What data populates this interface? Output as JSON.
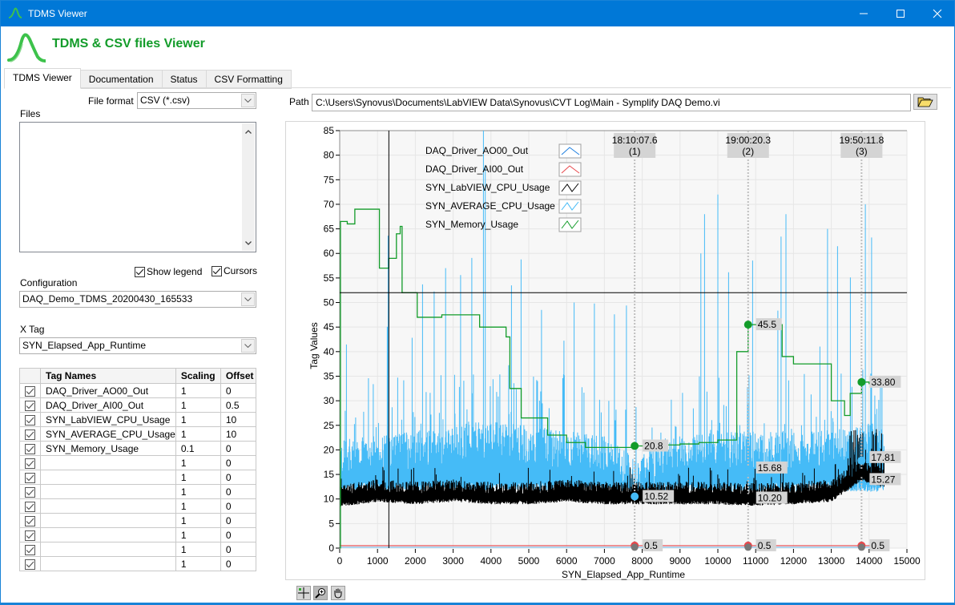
{
  "window": {
    "title": "TDMS Viewer",
    "controls": [
      "minimize",
      "maximize",
      "close"
    ]
  },
  "header": {
    "title": "TDMS & CSV files Viewer",
    "brand_color": "#139c2a"
  },
  "tabs": [
    {
      "label": "TDMS Viewer",
      "active": true
    },
    {
      "label": "Documentation",
      "active": false
    },
    {
      "label": "Status",
      "active": false
    },
    {
      "label": "CSV Formatting",
      "active": false
    }
  ],
  "left_panel": {
    "file_format_label": "File format",
    "file_format_value": "CSV (*.csv)",
    "files_label": "Files",
    "files": [],
    "show_legend_label": "Show legend",
    "show_legend_checked": true,
    "cursors_label": "Cursors",
    "cursors_checked": true,
    "configuration_label": "Configuration",
    "configuration_value": "DAQ_Demo_TDMS_20200430_165533",
    "xtag_label": "X Tag",
    "xtag_value": "SYN_Elapsed_App_Runtime"
  },
  "tag_table": {
    "headers": [
      "Tag Names",
      "Scaling",
      "Offset"
    ],
    "rows": [
      {
        "checked": true,
        "name": "DAQ_Driver_AO00_Out",
        "scaling": "1",
        "offset": "0"
      },
      {
        "checked": true,
        "name": "DAQ_Driver_AI00_Out",
        "scaling": "1",
        "offset": "0.5"
      },
      {
        "checked": true,
        "name": "SYN_LabVIEW_CPU_Usage",
        "scaling": "1",
        "offset": "10"
      },
      {
        "checked": true,
        "name": "SYN_AVERAGE_CPU_Usage",
        "scaling": "1",
        "offset": "10"
      },
      {
        "checked": true,
        "name": "SYN_Memory_Usage",
        "scaling": "0.1",
        "offset": "0"
      },
      {
        "checked": true,
        "name": "",
        "scaling": "1",
        "offset": "0"
      },
      {
        "checked": true,
        "name": "",
        "scaling": "1",
        "offset": "0"
      },
      {
        "checked": true,
        "name": "",
        "scaling": "1",
        "offset": "0"
      },
      {
        "checked": true,
        "name": "",
        "scaling": "1",
        "offset": "0"
      },
      {
        "checked": true,
        "name": "",
        "scaling": "1",
        "offset": "0"
      },
      {
        "checked": true,
        "name": "",
        "scaling": "1",
        "offset": "0"
      },
      {
        "checked": true,
        "name": "",
        "scaling": "1",
        "offset": "0"
      },
      {
        "checked": true,
        "name": "",
        "scaling": "1",
        "offset": "0"
      }
    ]
  },
  "path": {
    "label": "Path",
    "value": "C:\\Users\\Synovus\\Documents\\LabVIEW Data\\Synovus\\CVT Log\\Main - Symplify DAQ Demo.vi"
  },
  "palette_tools": [
    "cursor-move-tool",
    "zoom-tool",
    "pan-tool"
  ],
  "chart_data": {
    "type": "line",
    "title": "",
    "xlabel": "SYN_Elapsed_App_Runtime",
    "ylabel": "Tag Values",
    "xlim": [
      0,
      15000
    ],
    "ylim": [
      0,
      85
    ],
    "xticks": [
      0,
      1000,
      2000,
      3000,
      4000,
      5000,
      6000,
      7000,
      8000,
      9000,
      10000,
      11000,
      12000,
      13000,
      14000,
      15000
    ],
    "yticks": [
      0,
      5,
      10,
      15,
      20,
      25,
      30,
      35,
      40,
      45,
      50,
      55,
      60,
      65,
      70,
      75,
      80,
      85
    ],
    "grid": true,
    "legend_position": "top-left",
    "series": [
      {
        "name": "DAQ_Driver_AO00_Out",
        "color": "#1e7fe0",
        "x": [
          0,
          14400
        ],
        "y": [
          0,
          0
        ]
      },
      {
        "name": "DAQ_Driver_AI00_Out",
        "color": "#e8474c",
        "x": [
          0,
          14400
        ],
        "y": [
          0.5,
          0.5
        ]
      },
      {
        "name": "SYN_LabVIEW_CPU_Usage",
        "color": "#000000",
        "approx_baseline": 10.5,
        "approx_spike_max": 24,
        "x": [
          0,
          1000,
          2000,
          3000,
          4000,
          5000,
          6000,
          7000,
          7800,
          9000,
          10000,
          10800,
          12000,
          13000,
          13800,
          14300
        ],
        "y": [
          10,
          11,
          10.5,
          11,
          10.5,
          10.5,
          11,
          10.5,
          10.5,
          10.5,
          10.5,
          10.2,
          10.5,
          11,
          15.27,
          14
        ]
      },
      {
        "name": "SYN_AVERAGE_CPU_Usage",
        "color": "#45bbf7",
        "approx_baseline": 13,
        "approx_spike_max": 85,
        "x": [
          0,
          1000,
          2000,
          3000,
          4000,
          5000,
          6000,
          7000,
          7800,
          9000,
          10000,
          10800,
          12000,
          13000,
          13800,
          14300
        ],
        "y": [
          14,
          15,
          16,
          17,
          18,
          17,
          16,
          15,
          10.52,
          15,
          16,
          15.68,
          16,
          16,
          17.81,
          17
        ]
      },
      {
        "name": "SYN_Memory_Usage",
        "color": "#139c2a",
        "x": [
          0,
          20,
          200,
          400,
          1000,
          1050,
          1300,
          1500,
          1600,
          1650,
          1800,
          2000,
          2050,
          2700,
          3000,
          3700,
          4400,
          4500,
          4800,
          5500,
          6000,
          6500,
          7000,
          7800,
          8500,
          9000,
          9500,
          10000,
          10200,
          10450,
          10500,
          10800,
          11200,
          11700,
          12000,
          13000,
          13350,
          13500,
          13800,
          14000,
          14300
        ],
        "y": [
          0,
          66.5,
          66,
          69,
          69,
          57,
          59,
          64,
          65.5,
          52,
          52,
          52,
          47,
          47.5,
          47.5,
          45,
          43,
          32.5,
          26.5,
          23,
          21.5,
          20.5,
          20.5,
          20.8,
          21,
          21.2,
          21.5,
          22,
          22,
          22,
          40,
          45.5,
          45.5,
          39,
          37.5,
          30,
          27,
          31.5,
          33.8,
          33.5,
          35
        ]
      }
    ],
    "cursors": [
      {
        "id": 1,
        "label": "18:10:07.6",
        "index_label": "(1)",
        "x": 7800,
        "values": [
          {
            "series": "SYN_Memory_Usage",
            "y": "20.8"
          },
          {
            "series": "SYN_AVERAGE_CPU_Usage",
            "y": "10.52"
          },
          {
            "series": "DAQ_Driver_AI00_Out",
            "y": "0.5"
          }
        ]
      },
      {
        "id": 2,
        "label": "19:00:20.3",
        "index_label": "(2)",
        "x": 10800,
        "values": [
          {
            "series": "SYN_Memory_Usage",
            "y": "45.5"
          },
          {
            "series": "SYN_AVERAGE_CPU_Usage",
            "y": "15.68"
          },
          {
            "series": "SYN_LabVIEW_CPU_Usage",
            "y": "10.20"
          },
          {
            "series": "DAQ_Driver_AI00_Out",
            "y": "0.5"
          }
        ]
      },
      {
        "id": 3,
        "label": "19:50:11.8",
        "index_label": "(3)",
        "x": 13800,
        "values": [
          {
            "series": "SYN_Memory_Usage",
            "y": "33.80"
          },
          {
            "series": "SYN_AVERAGE_CPU_Usage",
            "y": "17.81"
          },
          {
            "series": "SYN_LabVIEW_CPU_Usage",
            "y": "15.27"
          },
          {
            "series": "DAQ_Driver_AI00_Out",
            "y": "0.5"
          }
        ]
      }
    ],
    "crosshair": {
      "x": 1300,
      "y": 52
    }
  }
}
